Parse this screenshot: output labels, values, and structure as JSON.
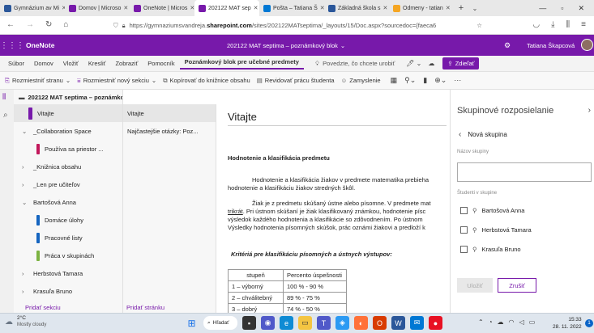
{
  "browser": {
    "tabs": [
      {
        "label": "Gymnázium av Mi",
        "color": "#2b579a",
        "active": false
      },
      {
        "label": "Domov | Microso",
        "color": "#7719aa",
        "active": false
      },
      {
        "label": "OneNote | Micros",
        "color": "#7719aa",
        "active": false
      },
      {
        "label": "202122 MAT sep",
        "color": "#7719aa",
        "active": true
      },
      {
        "label": "Pošta – Tatiana Š",
        "color": "#0078d4",
        "active": false
      },
      {
        "label": "Základná škola s",
        "color": "#2b579a",
        "active": false
      },
      {
        "label": "Odmeny - tatian",
        "color": "#f5a623",
        "active": false
      }
    ],
    "url_prefix": "https://gymnaziumsvandreja.",
    "url_domain": "sharepoint.com",
    "url_suffix": "/sites/202122MATseptima/_layouts/15/Doc.aspx?sourcedoc={faeca6"
  },
  "header": {
    "app_name": "OneNote",
    "title": "202122 MAT septima – poznámkový blok",
    "user": "Tatiana Škapcová"
  },
  "ribbon": {
    "tabs": [
      "Súbor",
      "Domov",
      "Vložiť",
      "Kresliť",
      "Zobraziť",
      "Pomocník",
      "Poznámkový blok pre učebné predmety"
    ],
    "tell_me": "Povedzte, čo chcete urobiť",
    "share": "Zdieľať"
  },
  "toolbar": {
    "redistribute_page": "Rozmiestniť stranu",
    "redistribute_section": "Rozmiestniť nový sekciu",
    "copy_to_library": "Kopírovať do knižnice obsahu",
    "review_work": "Revidovať prácu študenta",
    "reflect": "Zamyslenie"
  },
  "nav": {
    "notebook": "202122 MAT septima – poznámkový blok",
    "sections": [
      {
        "label": "Vitajte",
        "color": "#7719aa",
        "indent": 0,
        "kind": "section"
      },
      {
        "label": "_Collaboration Space",
        "indent": 0,
        "kind": "group",
        "open": true
      },
      {
        "label": "Používa sa priestor ...",
        "color": "#c2185b",
        "indent": 1,
        "kind": "section"
      },
      {
        "label": "_Knižnica obsahu",
        "indent": 0,
        "kind": "group",
        "open": false
      },
      {
        "label": "_Len pre učiteľov",
        "indent": 0,
        "kind": "group",
        "open": false
      },
      {
        "label": "Bartošová Anna",
        "indent": 0,
        "kind": "group",
        "open": true
      },
      {
        "label": "Domáce úlohy",
        "color": "#1565c0",
        "indent": 1,
        "kind": "section"
      },
      {
        "label": "Pracovné listy",
        "color": "#1565c0",
        "indent": 1,
        "kind": "section"
      },
      {
        "label": "Práca v skupinách",
        "color": "#7cb342",
        "indent": 1,
        "kind": "section"
      },
      {
        "label": "Herbstová Tamara",
        "indent": 0,
        "kind": "group",
        "open": false
      },
      {
        "label": "Krasuľa Bruno",
        "indent": 0,
        "kind": "group",
        "open": false
      }
    ],
    "add_section": "Pridať sekciu",
    "pages": [
      "Vitajte",
      "Najčastejšie otázky: Poz..."
    ],
    "add_page": "Pridať stránku"
  },
  "page": {
    "title": "Vitajte",
    "heading": "Hodnotenie a klasifikácia predmetu",
    "p1a": "Hodnotenie a klasifikácia žiakov v predmete matematika prebieha",
    "p1b": "hodnotenie a klasifikáciu žiakov stredných škôl.",
    "p2a": "Žiak je z predmetu skúšaný ústne alebo písomne. V predmete mat",
    "p2b_u": "trikrát",
    "p2b": ". Pri ústnom skúšaní je žiak klasifikovaný známkou, hodnotenie písc",
    "p2c": "výsledok každého hodnotenia a klasifikácie so zdôvodnením. Po ústnom",
    "p2d": "Výsledky hodnotenia písomných skúšok, prác oznámi žiakovi a predloží k",
    "criteria": "Kritériá pre klasifikáciu písomných a ústnych výstupov:",
    "table": {
      "headers": [
        "stupeň",
        "Percento úspešnosti"
      ],
      "rows": [
        [
          "1 – výborný",
          "100 % - 90 %"
        ],
        [
          "2 – chválitebný",
          "89 % - 75 %"
        ],
        [
          "3 – dobrý",
          "74 % - 50 %"
        ]
      ]
    }
  },
  "pane": {
    "title": "Skupinové rozposielanie",
    "back": "Nová skupina",
    "name_label": "Názov skupiny",
    "students_label": "Študenti v skupine",
    "students": [
      "Bartošová Anna",
      "Herbstová Tamara",
      "Krasuľa Bruno"
    ],
    "save": "Uložiť",
    "cancel": "Zrušiť"
  },
  "taskbar": {
    "temp": "2°C",
    "weather": "Mostly cloudy",
    "search": "Hľadať",
    "time": "15:33",
    "date": "28. 11. 2022",
    "badge": "1"
  }
}
